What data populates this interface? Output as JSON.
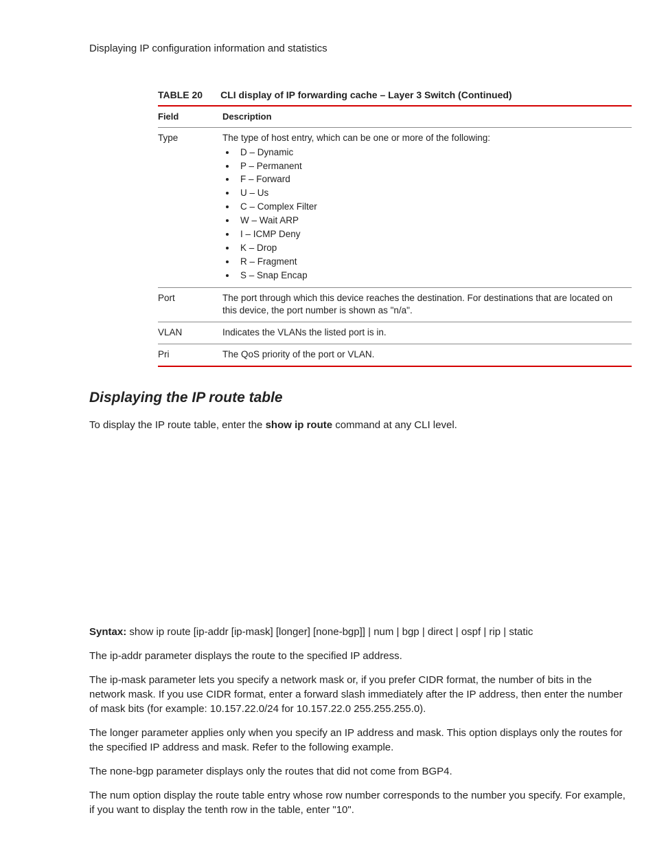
{
  "header": "Displaying IP configuration information and statistics",
  "table": {
    "number": "TABLE 20",
    "title": "CLI display of IP forwarding cache – Layer 3 Switch (Continued)",
    "columns": {
      "field": "Field",
      "desc": "Description"
    },
    "rows": {
      "type": {
        "field": "Type",
        "intro": "The type of host entry, which can be one or more of the following:",
        "bullets": [
          "D – Dynamic",
          "P – Permanent",
          "F – Forward",
          "U – Us",
          "C – Complex Filter",
          "W – Wait ARP",
          "I – ICMP Deny",
          "K – Drop",
          "R – Fragment",
          "S – Snap Encap"
        ]
      },
      "port": {
        "field": "Port",
        "desc": "The port through which this device reaches the destination.  For destinations that are located on this device, the port number is shown as \"n/a\"."
      },
      "vlan": {
        "field": "VLAN",
        "desc": "Indicates the VLANs the listed port is in."
      },
      "pri": {
        "field": "Pri",
        "desc": "The QoS priority of the port or VLAN."
      }
    }
  },
  "section": {
    "title": "Displaying the IP route table",
    "intro_pre": "To display the IP route table, enter the ",
    "intro_cmd": "show ip route",
    "intro_post": " command at any CLI level."
  },
  "syntax": {
    "label": "Syntax:  ",
    "cmd": "show ip route",
    "seg_open1": " [",
    "ipaddr": "ip-addr",
    "seg_open2": " [",
    "ipmask": "ip-mask",
    "seg_close2": "]",
    "seg_open3": " [",
    "longer": "longer",
    "seg_close3": "]",
    "seg_open4": " [",
    "nonebgp": "none-bgp",
    "seg_close4": "]] | ",
    "num": "num",
    "pipe": " | ",
    "bgp": "bgp",
    "direct": "direct",
    "ospf": "ospf",
    "rip": "rip",
    "static": "static"
  },
  "p1": {
    "pre": "The ",
    "var": "ip-addr",
    "post": " parameter displays the route to the specified IP address."
  },
  "p2": {
    "pre": "The ",
    "var": "ip-mask",
    "post": " parameter lets you specify a network mask or, if you prefer CIDR format, the number of bits in the network mask.  If you use CIDR format, enter a forward slash immediately after the IP address, then enter the number of mask bits (for example:  10.157.22.0/24 for 10.157.22.0 255.255.255.0)."
  },
  "p3": {
    "pre": "The ",
    "kw": "longer",
    "post": " parameter applies only when you specify an IP address and mask.  This option displays only the routes for the specified IP address and mask.  Refer to the following example."
  },
  "p4": {
    "pre": "The ",
    "kw": "none-bgp",
    "post": " parameter displays only the routes that did not come from BGP4."
  },
  "p5": {
    "pre": "The ",
    "var": "num",
    "post": " option display the route table entry whose row number corresponds to the number you specify.  For example, if you want to display the tenth row in the table, enter \"10\"."
  }
}
